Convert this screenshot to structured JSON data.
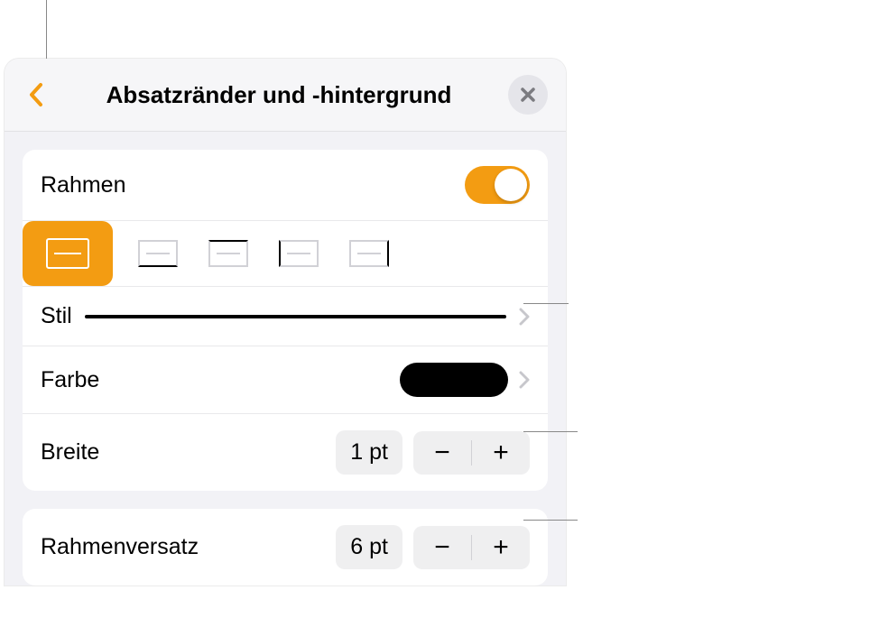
{
  "header": {
    "title": "Absatzränder und -hintergrund"
  },
  "rahmen": {
    "label": "Rahmen",
    "toggle": true
  },
  "stil": {
    "label": "Stil"
  },
  "farbe": {
    "label": "Farbe",
    "color": "#000000"
  },
  "breite": {
    "label": "Breite",
    "value": "1 pt"
  },
  "rahmenversatz": {
    "label": "Rahmenversatz",
    "value": "6 pt"
  },
  "icons": {
    "minus": "−",
    "plus": "+"
  }
}
